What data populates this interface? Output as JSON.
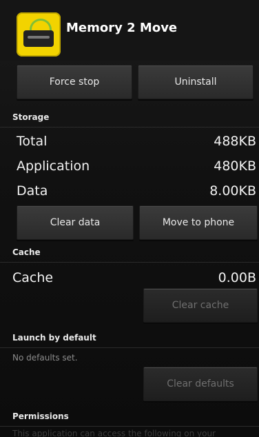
{
  "app": {
    "title": "Memory 2 Move"
  },
  "buttons": {
    "force_stop": "Force stop",
    "uninstall": "Uninstall",
    "clear_data": "Clear data",
    "move_to_phone": "Move to phone",
    "clear_cache": "Clear cache",
    "clear_defaults": "Clear defaults"
  },
  "storage": {
    "heading": "Storage",
    "rows": [
      {
        "label": "Total",
        "value": "488KB"
      },
      {
        "label": "Application",
        "value": "480KB"
      },
      {
        "label": "Data",
        "value": "8.00KB"
      }
    ]
  },
  "cache": {
    "heading": "Cache",
    "row": {
      "label": "Cache",
      "value": "0.00B"
    }
  },
  "launch_by_default": {
    "heading": "Launch by default",
    "status": "No defaults set."
  },
  "permissions": {
    "heading": "Permissions",
    "text": "This application can access the following on your"
  }
}
